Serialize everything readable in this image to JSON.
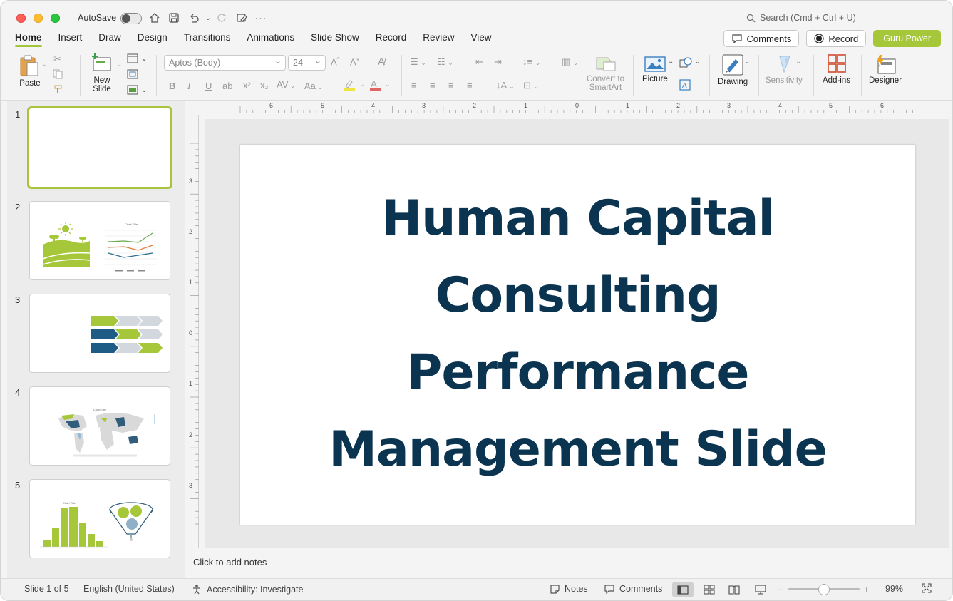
{
  "titlebar": {
    "autosave_label": "AutoSave",
    "search_placeholder": "Search (Cmd + Ctrl + U)"
  },
  "tabs": [
    {
      "label": "Home",
      "active": true
    },
    {
      "label": "Insert"
    },
    {
      "label": "Draw"
    },
    {
      "label": "Design"
    },
    {
      "label": "Transitions"
    },
    {
      "label": "Animations"
    },
    {
      "label": "Slide Show"
    },
    {
      "label": "Record"
    },
    {
      "label": "Review"
    },
    {
      "label": "View"
    }
  ],
  "header_buttons": {
    "comments": "Comments",
    "record": "Record",
    "guru": "Guru Power"
  },
  "ribbon": {
    "paste": "Paste",
    "new_slide_1": "New",
    "new_slide_2": "Slide",
    "font_name": "Aptos (Body)",
    "font_size": "24",
    "convert_1": "Convert to",
    "convert_2": "SmartArt",
    "picture": "Picture",
    "drawing": "Drawing",
    "sensitivity": "Sensitivity",
    "addins": "Add-ins",
    "designer": "Designer"
  },
  "thumbnails": [
    "1",
    "2",
    "3",
    "4",
    "5"
  ],
  "thumb_text": {
    "chart_title": "Chart Title"
  },
  "ruler": {
    "horizontal": [
      "6",
      "5",
      "4",
      "3",
      "2",
      "1",
      "0",
      "1",
      "2",
      "3",
      "4",
      "5",
      "6"
    ],
    "vertical": [
      "3",
      "2",
      "1",
      "0",
      "1",
      "2",
      "3"
    ]
  },
  "slide": {
    "title_lines": [
      "Human Capital",
      "Consulting",
      "Performance",
      "Management Slide"
    ]
  },
  "notes_placeholder": "Click to add notes",
  "status": {
    "slide_info": "Slide 1 of 5",
    "language": "English (United States)",
    "accessibility": "Accessibility: Investigate",
    "notes": "Notes",
    "comments": "Comments",
    "zoom": "99%"
  },
  "colors": {
    "accent_green": "#a6c73a",
    "title_navy": "#0b3450"
  }
}
